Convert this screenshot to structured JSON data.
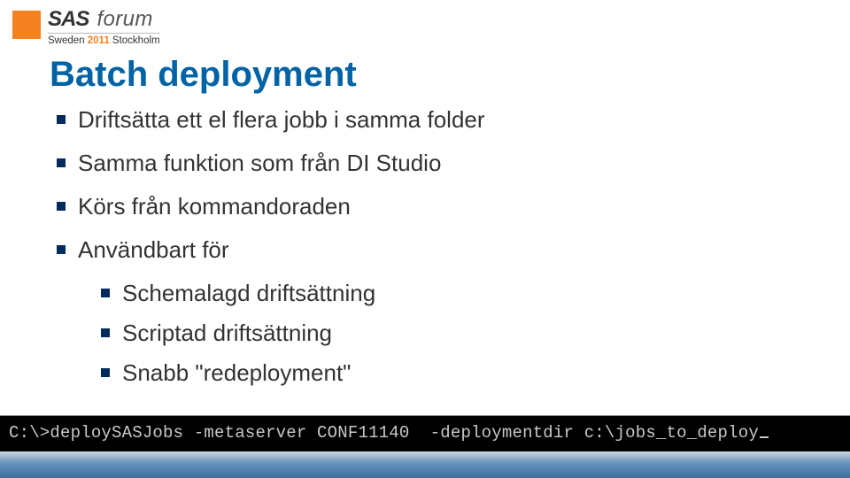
{
  "header": {
    "brand_sas": "SAS",
    "brand_forum": "forum",
    "sub_left": "Sweden",
    "sub_year": "2011",
    "sub_city": "Stockholm"
  },
  "title": "Batch deployment",
  "bullets": {
    "b0": "Driftsätta ett el flera jobb i samma folder",
    "b1": "Samma funktion som från DI Studio",
    "b2": "Körs från kommandoraden",
    "b3": "Användbart för",
    "sub": {
      "s0": "Schemalagd driftsättning",
      "s1": "Scriptad driftsättning",
      "s2": "Snabb \"redeployment\""
    }
  },
  "terminal": {
    "line": "C:\\>deploySASJobs -metaserver CONF11140  -deploymentdir c:\\jobs_to_deploy"
  }
}
